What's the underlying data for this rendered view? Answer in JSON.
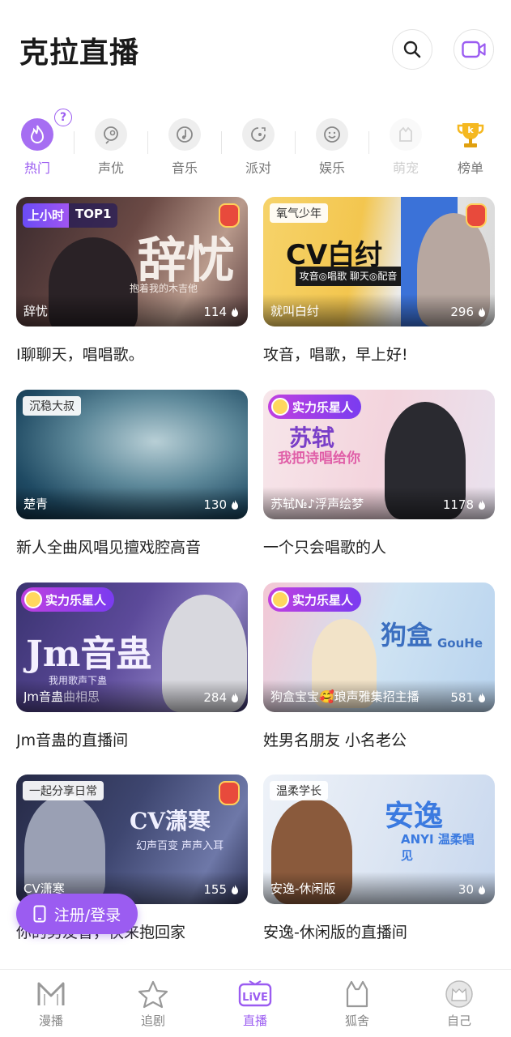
{
  "header": {
    "title": "克拉直播"
  },
  "categories": [
    {
      "label": "热门",
      "icon": "flame-icon"
    },
    {
      "label": "声优",
      "icon": "mic-bubble-icon"
    },
    {
      "label": "音乐",
      "icon": "music-note-icon"
    },
    {
      "label": "派对",
      "icon": "party-icon"
    },
    {
      "label": "娱乐",
      "icon": "smile-icon"
    },
    {
      "label": "萌宠",
      "icon": "pet-icon"
    },
    {
      "label": "榜单",
      "icon": "trophy-icon"
    }
  ],
  "help_badge": "?",
  "cards": [
    {
      "tag": "",
      "badge_top": [
        "上小时",
        "TOP1"
      ],
      "art_text": "辞忧",
      "art_sub": "抱着我的木吉他",
      "name": "辞忧",
      "count": "114",
      "desc": "I聊聊天，唱唱歌。"
    },
    {
      "tag": "氧气少年",
      "art_text": "CV白纣",
      "art_sub": "攻音◎唱歌  聊天◎配音",
      "name": "就叫白纣",
      "count": "296",
      "desc": "攻音，唱歌，早上好!"
    },
    {
      "tag": "沉稳大叔",
      "name": "楚青",
      "count": "130",
      "desc": "新人全曲风唱见擅戏腔高音"
    },
    {
      "badge": "实力乐星人",
      "art_text": "苏轼",
      "art_sub": "我把诗唱给你",
      "name": "苏轼№♪浮声绘梦",
      "count": "1178",
      "desc": "一个只会唱歌的人"
    },
    {
      "badge": "实力乐星人",
      "art_text": "Jm音蛊",
      "art_sub": "我用歌声下蛊",
      "name": "Jm音蛊",
      "name_extra": "曲相思",
      "count": "284",
      "desc": "Jm音蛊的直播间"
    },
    {
      "badge": "实力乐星人",
      "art_text": "狗盒",
      "art_sub": "GouHe",
      "name": "狗盒宝宝🥰琅声雅集招主播",
      "count": "581",
      "desc": "姓男名朋友 小名老公"
    },
    {
      "tag": "一起分享日常",
      "art_text": "CV潇寒",
      "art_sub": "幻声百变 声声入耳",
      "name": "CV潇寒",
      "count": "155",
      "desc": "你的男友音，快来抱回家"
    },
    {
      "tag": "温柔学长",
      "art_text": "安逸",
      "art_sub": "ANYI 温柔唱见",
      "name": "安逸-休闲版",
      "count": "30",
      "desc": "安逸-休闲版的直播间"
    }
  ],
  "login_button": "注册/登录",
  "tabbar": [
    {
      "label": "漫播",
      "icon": "manbo-logo-icon"
    },
    {
      "label": "追剧",
      "icon": "star-icon"
    },
    {
      "label": "直播",
      "icon": "live-tv-icon",
      "active": true
    },
    {
      "label": "狐舍",
      "icon": "fox-icon"
    },
    {
      "label": "自己",
      "icon": "avatar-icon"
    }
  ],
  "colors": {
    "accent": "#9b5cf1",
    "text": "#222222",
    "muted": "#888888"
  }
}
